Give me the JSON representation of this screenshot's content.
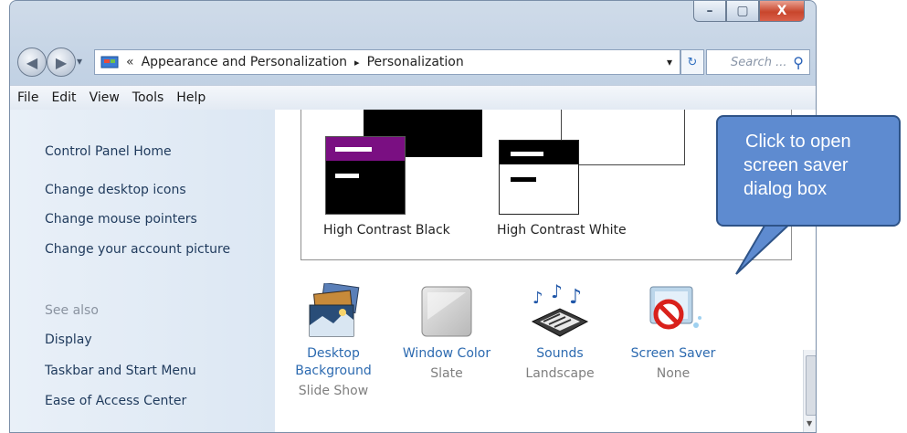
{
  "window": {
    "controls": {
      "minimize": "–",
      "maximize": "▢",
      "close": "X"
    }
  },
  "address_bar": {
    "back_icon": "◀",
    "forward_icon": "▶",
    "dropdown_icon": "▾",
    "chevrons": "«",
    "crumb1": "Appearance and Personalization",
    "sep": "▸",
    "crumb2": "Personalization",
    "refresh_icon": "↻",
    "search_placeholder": "Search ...",
    "search_icon": "⚲"
  },
  "menu": [
    "File",
    "Edit",
    "View",
    "Tools",
    "Help"
  ],
  "sidebar": {
    "home": "Control Panel Home",
    "links": [
      "Change desktop icons",
      "Change mouse pointers",
      "Change your account picture"
    ],
    "see_also_title": "See also",
    "see_also": [
      "Display",
      "Taskbar and Start Menu",
      "Ease of Access Center"
    ]
  },
  "themes": [
    {
      "name": "High Contrast Black"
    },
    {
      "name": "High Contrast White"
    }
  ],
  "settings": [
    {
      "title_line1": "Desktop",
      "title_line2": "Background",
      "value": "Slide Show",
      "icon": "desktop-background-icon"
    },
    {
      "title_line1": "Window Color",
      "title_line2": "",
      "value": "Slate",
      "icon": "window-color-icon"
    },
    {
      "title_line1": "Sounds",
      "title_line2": "",
      "value": "Landscape",
      "icon": "sounds-icon"
    },
    {
      "title_line1": "Screen Saver",
      "title_line2": "",
      "value": "None",
      "icon": "screen-saver-icon"
    }
  ],
  "callout": {
    "line1": "Click to open",
    "line2": "screen saver",
    "line3": "dialog box"
  },
  "colors": {
    "link": "#2c6ab0",
    "callout_fill": "#5e8bd0",
    "hc_purple": "#7a0f82"
  }
}
